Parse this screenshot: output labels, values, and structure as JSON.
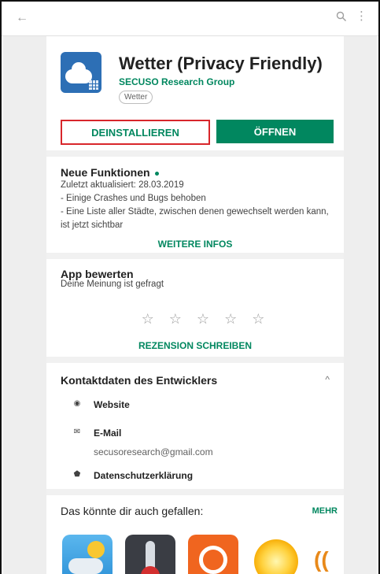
{
  "app": {
    "title": "Wetter (Privacy Friendly)",
    "developer": "SECUSO Research Group",
    "category_tag": "Wetter",
    "uninstall_label": "DEINSTALLIEREN",
    "open_label": "ÖFFNEN"
  },
  "whats_new": {
    "heading": "Neue Funktionen",
    "updated": "Zuletzt aktualisiert: 28.03.2019",
    "line1": "- Einige Crashes und Bugs behoben",
    "line2": "- Eine Liste aller Städte, zwischen denen gewechselt werden kann, ist jetzt sichtbar",
    "more_label": "WEITERE INFOS"
  },
  "rating": {
    "heading": "App bewerten",
    "subtitle": "Deine Meinung ist gefragt",
    "stars": [
      "☆",
      "☆",
      "☆",
      "☆",
      "☆"
    ],
    "write_review_label": "REZENSION SCHREIBEN"
  },
  "contact": {
    "heading": "Kontaktdaten des Entwicklers",
    "website_label": "Website",
    "email_label": "E-Mail",
    "email_value": "secusoresearch@gmail.com",
    "privacy_label": "Datenschutzerklärung"
  },
  "suggestions": {
    "heading": "Das könnte dir auch gefallen:",
    "more_label": "MEHR"
  },
  "icons": {
    "back": "←",
    "more": "⋮",
    "caret_up": "^",
    "globe": "◉",
    "mail": "✉",
    "shield": "⬟",
    "partial_app": "(("
  },
  "colors": {
    "accent_green": "#01875f",
    "highlight_red": "#d8262b"
  }
}
